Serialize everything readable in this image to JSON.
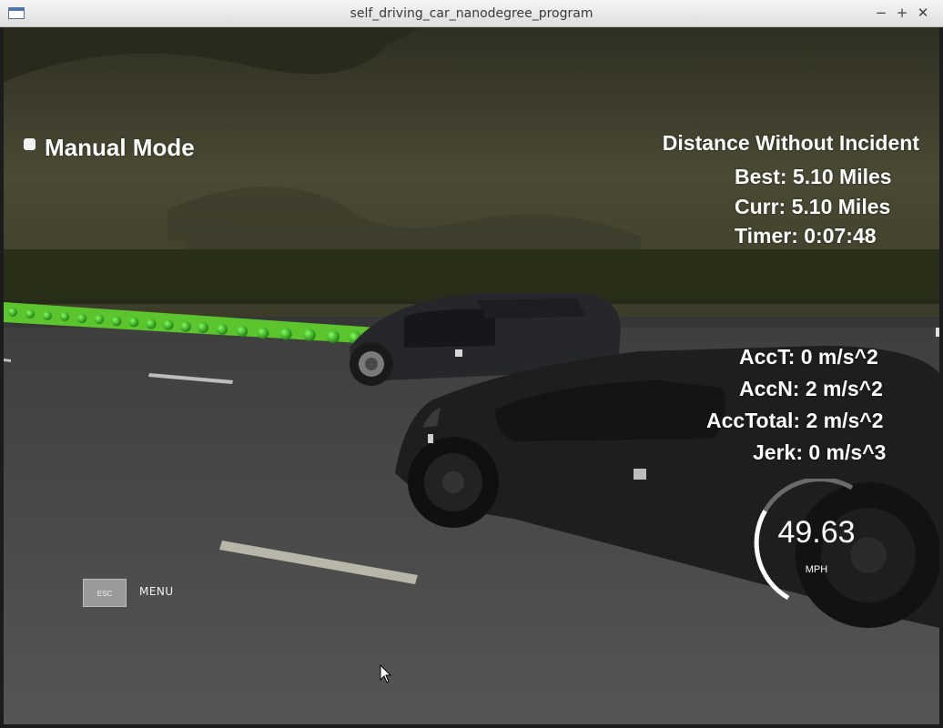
{
  "window": {
    "title": "self_driving_car_nanodegree_program",
    "controls": {
      "minimize": "−",
      "maximize": "+",
      "close": "✕"
    }
  },
  "hud": {
    "mode_label": "Manual Mode",
    "distance_heading": "Distance Without Incident",
    "best": "Best: 5.10 Miles",
    "curr": "Curr: 5.10 Miles",
    "timer": "Timer: 0:07:48",
    "acc_t": "AccT: 0 m/s^2",
    "acc_n": "AccN: 2 m/s^2",
    "acc_total": "AccTotal: 2 m/s^2",
    "jerk": "Jerk: 0 m/s^3"
  },
  "speedometer": {
    "value": "49.63",
    "unit": "MPH",
    "arc_fraction": 0.5
  },
  "menu": {
    "esc_key": "ESC",
    "label": "MENU"
  },
  "colors": {
    "path_green": "#6ed63a",
    "hud_text": "#ffffff"
  }
}
